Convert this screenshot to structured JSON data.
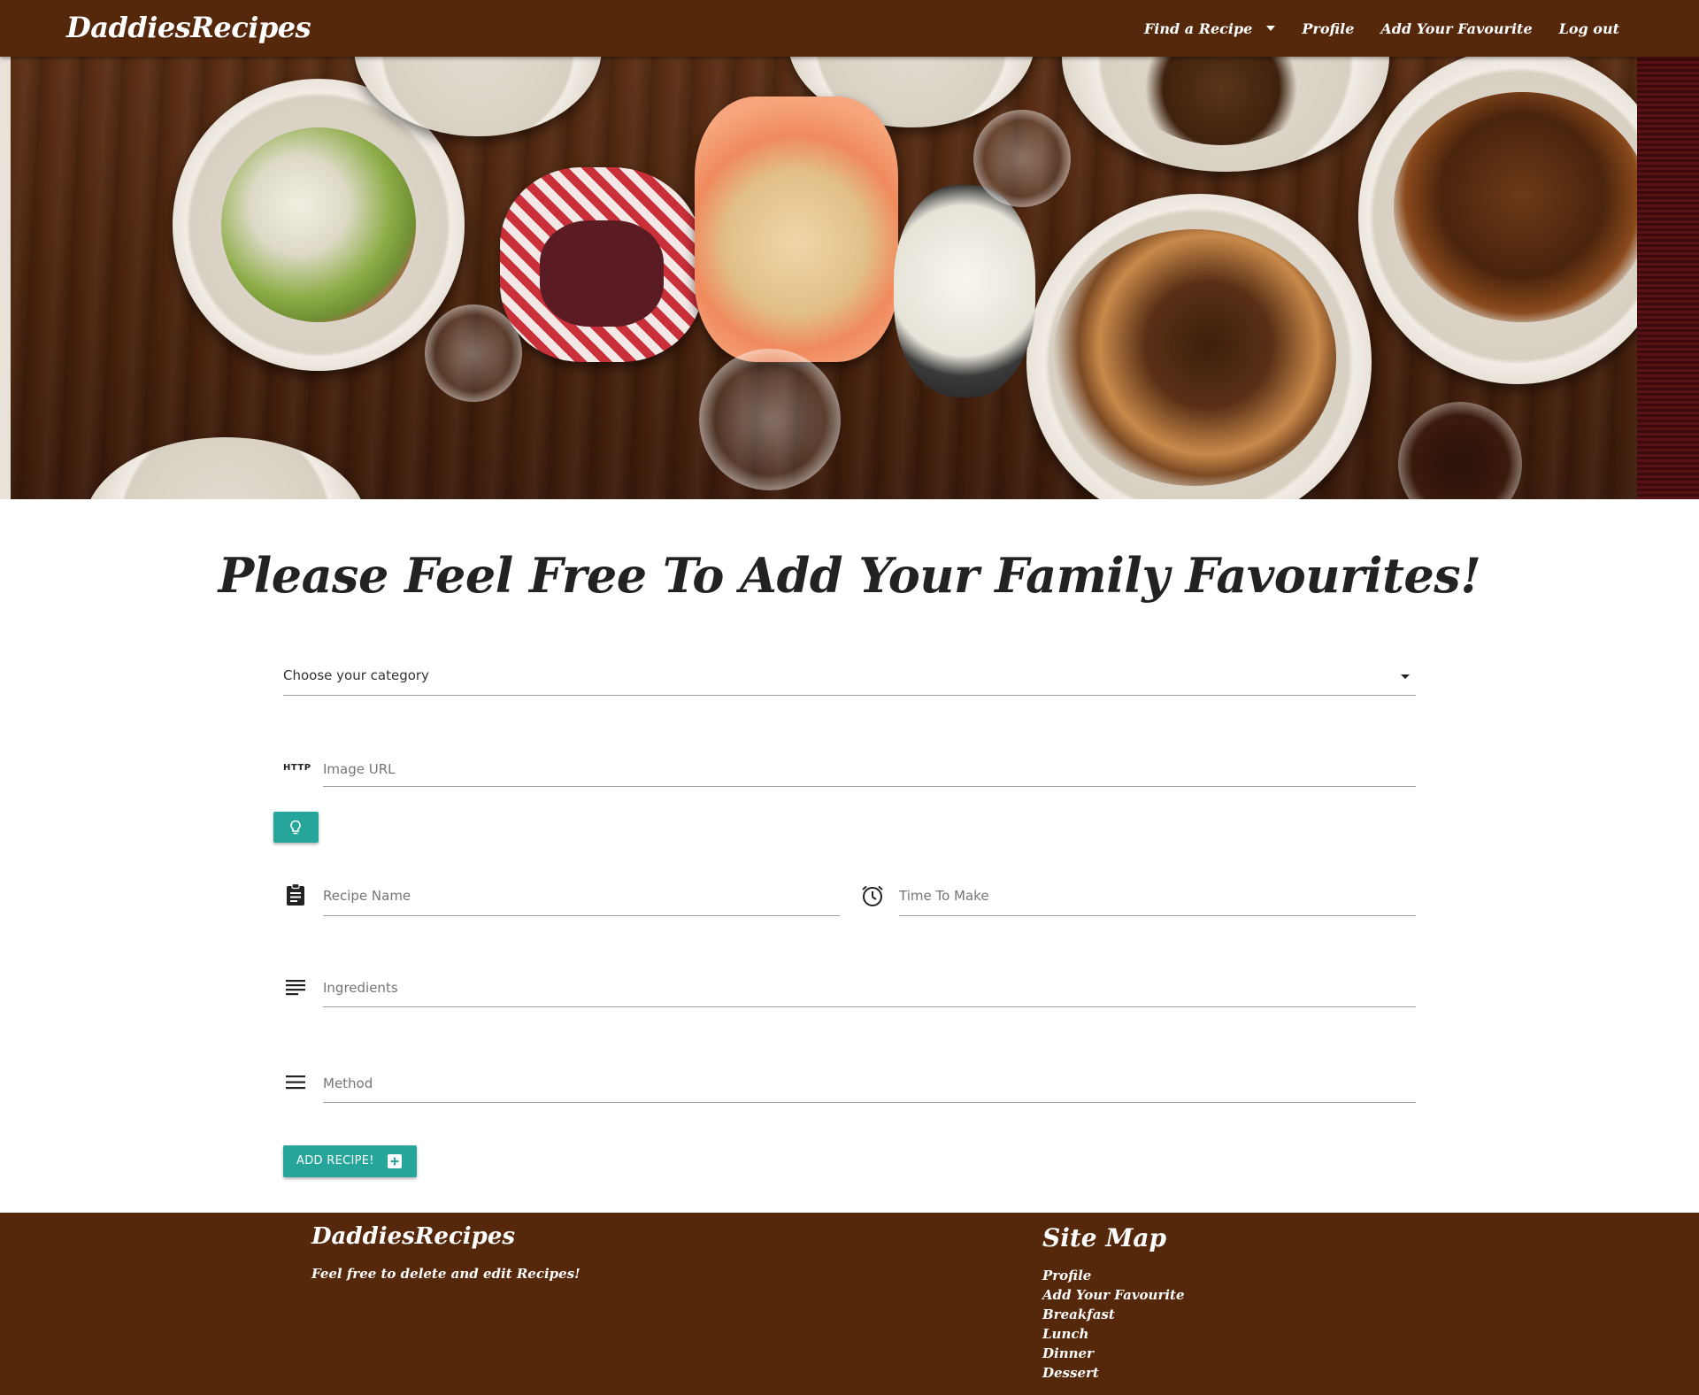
{
  "navbar": {
    "brand": "DaddiesRecipes",
    "links": {
      "find_recipe": "Find a Recipe",
      "profile": "Profile",
      "add_favourite": "Add Your Favourite",
      "logout": "Log out"
    }
  },
  "main": {
    "heading": "Please Feel Free To Add Your Family Favourites!",
    "category_select": {
      "value": "Choose your category"
    },
    "image_url": {
      "prefix": "HTTP",
      "placeholder": "Image URL"
    },
    "recipe_name": {
      "placeholder": "Recipe Name"
    },
    "time_to_make": {
      "placeholder": "Time To Make"
    },
    "ingredients": {
      "placeholder": "Ingredients"
    },
    "method": {
      "placeholder": "Method"
    },
    "submit_label": "ADD RECIPE!"
  },
  "footer": {
    "brand": "DaddiesRecipes",
    "tagline": "Feel free to delete and edit Recipes!",
    "sitemap_title": "Site Map",
    "sitemap": [
      "Profile",
      "Add Your Favourite",
      "Breakfast",
      "Lunch",
      "Dinner",
      "Dessert"
    ]
  },
  "colors": {
    "brand_brown": "#55280b",
    "accent_teal": "#26a69a"
  },
  "icons": [
    "chevron-down-icon",
    "lightbulb-icon",
    "clipboard-icon",
    "alarm-clock-icon",
    "notes-icon",
    "menu-lines-icon",
    "plus-box-icon"
  ]
}
